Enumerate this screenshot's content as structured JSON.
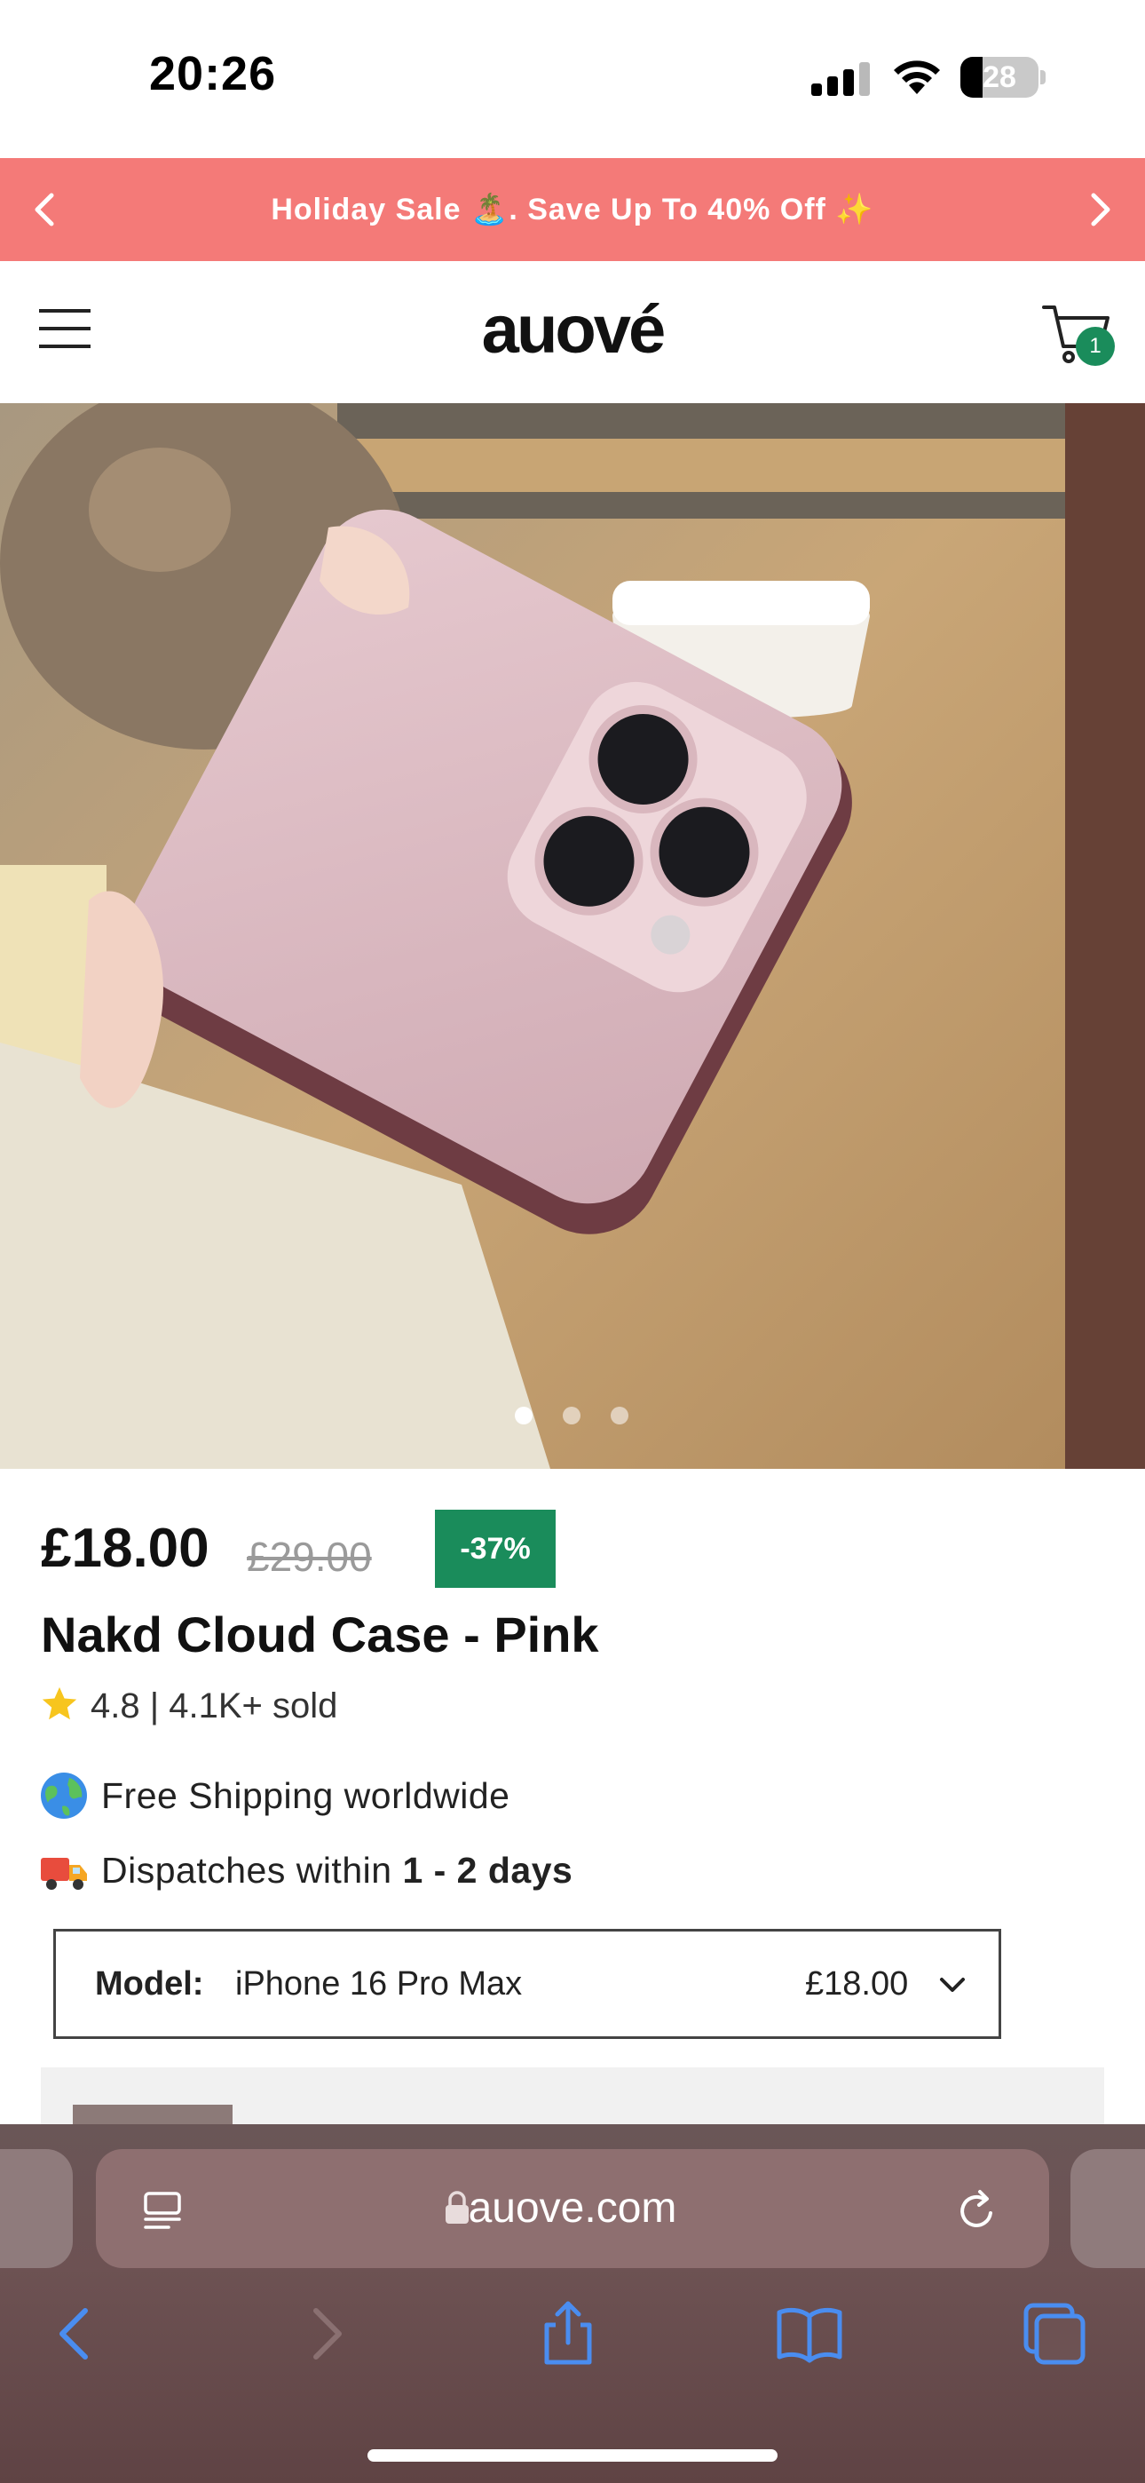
{
  "status_bar": {
    "time": "20:26",
    "battery": "28",
    "battery_level": 0.28
  },
  "announcement": {
    "text": "Holiday Sale 🏝️. Save Up To 40% Off ✨"
  },
  "header": {
    "logo": "auové",
    "cart_count": "1"
  },
  "gallery": {
    "active_dot": 0,
    "dot_count": 3
  },
  "product": {
    "price": "£18.00",
    "old_price": "£29.00",
    "discount": "-37%",
    "title": "Nakd Cloud Case - Pink",
    "rating": "4.8 | 4.1K+ sold",
    "shipping_text": "Free Shipping worldwide",
    "dispatch_prefix": "Dispatches within ",
    "dispatch_days": "1 - 2 days"
  },
  "variant": {
    "label": "Model:",
    "value": "iPhone 16 Pro Max",
    "price": "£18.00"
  },
  "browser": {
    "url": "auove.com"
  },
  "colors": {
    "announcement_bg": "#f47a78",
    "accent_green": "#1a8c5b",
    "browser_bg": "#6d5253",
    "safari_blue": "#4a8df0"
  }
}
